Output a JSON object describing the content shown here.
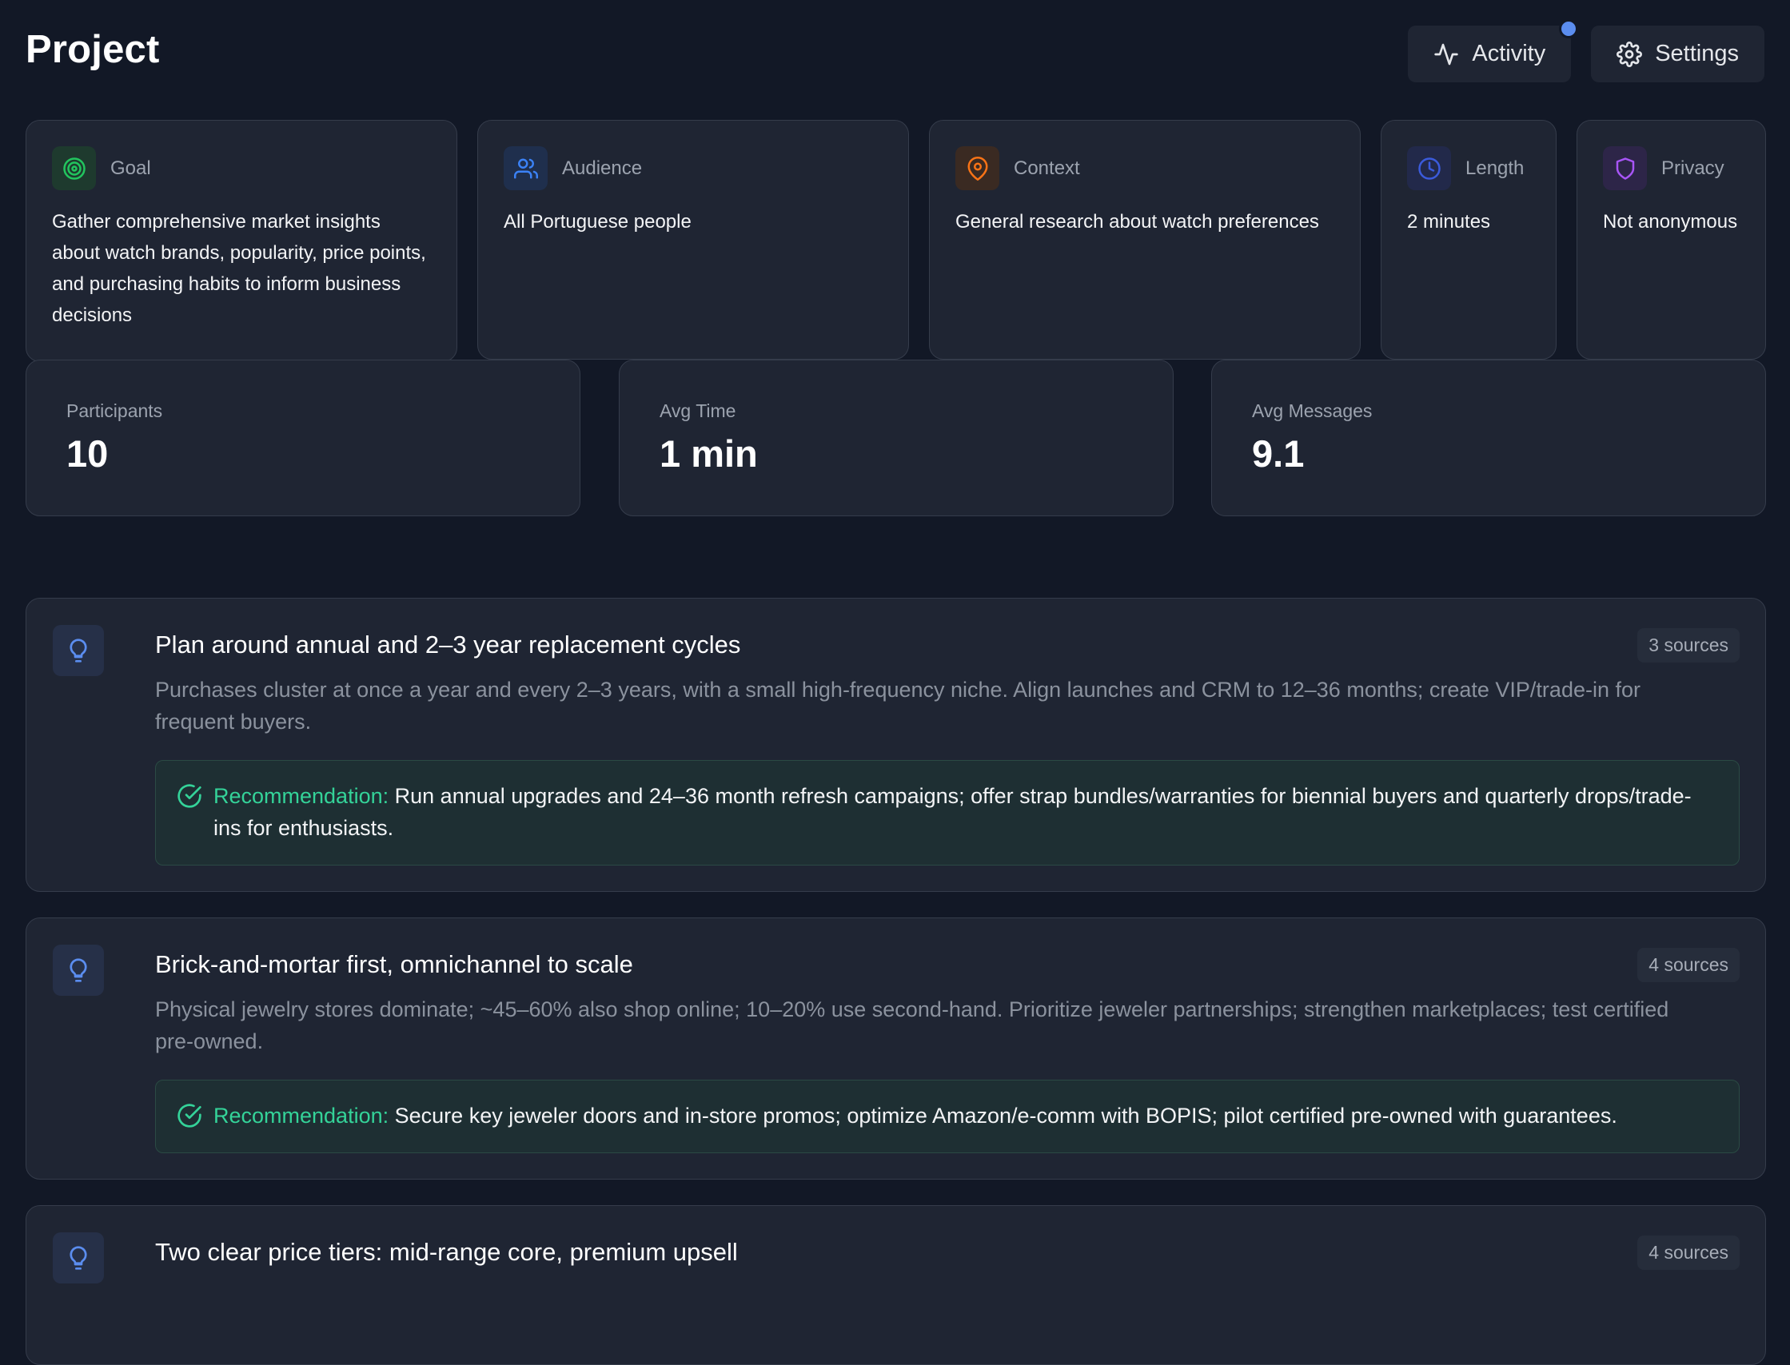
{
  "header": {
    "title": "Project",
    "activity_label": "Activity",
    "settings_label": "Settings"
  },
  "info_cards": [
    {
      "label": "Goal",
      "value": "Gather comprehensive market insights about watch brands, popularity, price points, and purchasing habits to inform business decisions",
      "icon": "target-icon",
      "color": "#22c55e"
    },
    {
      "label": "Audience",
      "value": "All Portuguese people",
      "icon": "users-icon",
      "color": "#3b82f6"
    },
    {
      "label": "Context",
      "value": "General research about watch preferences",
      "icon": "map-pin-icon",
      "color": "#f97316"
    },
    {
      "label": "Length",
      "value": "2 minutes",
      "icon": "clock-icon",
      "color": "#3b5bdb"
    },
    {
      "label": "Privacy",
      "value": "Not anonymous",
      "icon": "shield-icon",
      "color": "#a855f7"
    }
  ],
  "stats": [
    {
      "label": "Participants",
      "value": "10"
    },
    {
      "label": "Avg Time",
      "value": "1 min"
    },
    {
      "label": "Avg Messages",
      "value": "9.1"
    }
  ],
  "insights": [
    {
      "title": "Plan around annual and 2–3 year replacement cycles",
      "sources": "3 sources",
      "summary": "Purchases cluster at once a year and every 2–3 years, with a small high-frequency niche. Align launches and CRM to 12–36 months; create VIP/trade-in for frequent buyers.",
      "rec_label": "Recommendation:",
      "rec_text": "Run annual upgrades and 24–36 month refresh campaigns; offer strap bundles/warranties for biennial buyers and quarterly drops/trade-ins for enthusiasts."
    },
    {
      "title": "Brick-and-mortar first, omnichannel to scale",
      "sources": "4 sources",
      "summary": "Physical jewelry stores dominate; ~45–60% also shop online; 10–20% use second-hand. Prioritize jeweler partnerships; strengthen marketplaces; test certified pre-owned.",
      "rec_label": "Recommendation:",
      "rec_text": "Secure key jeweler doors and in-store promos; optimize Amazon/e-comm with BOPIS; pilot certified pre-owned with guarantees."
    },
    {
      "title": "Two clear price tiers: mid-range core, premium upsell",
      "sources": "4 sources"
    }
  ],
  "colors": {
    "background": "#121826",
    "card": "#1f2533",
    "accent": "#5b8def",
    "recommendation": "#34d399"
  }
}
